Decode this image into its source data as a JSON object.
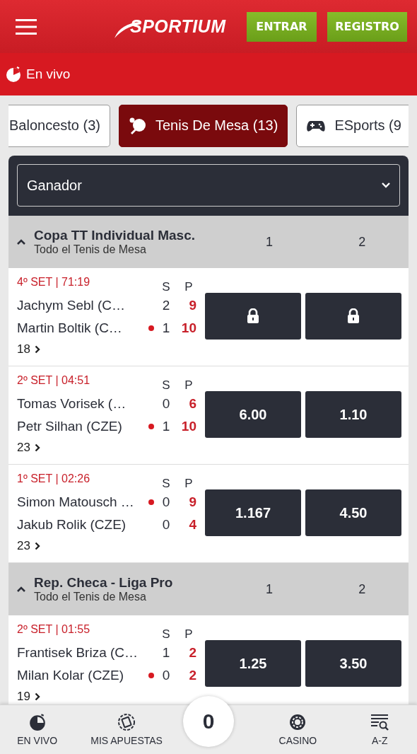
{
  "header": {
    "logo": "SPORTIUM",
    "buttons": [
      {
        "label": "ENTRAR"
      },
      {
        "label": "REGISTRO"
      }
    ]
  },
  "live_bar": {
    "label": "En vivo"
  },
  "sport_tabs": [
    {
      "label": "Baloncesto (3)",
      "selected": false,
      "kind": "plain"
    },
    {
      "label": "Tenis De Mesa (13)",
      "selected": true,
      "kind": "paddle"
    },
    {
      "label": "ESports (9",
      "selected": false,
      "kind": "gamepad"
    }
  ],
  "market_select": {
    "value": "Ganador"
  },
  "groups": [
    {
      "title": "Copa TT Individual Masc.",
      "subtitle": "Todo el Tenis de Mesa",
      "expanded": true,
      "columns": [
        "1",
        "2"
      ],
      "matches": [
        {
          "status": "4º SET | 71:19",
          "score_headers": [
            "S",
            "P"
          ],
          "players": [
            {
              "name": "Jachym Sebl (C…",
              "serving": false,
              "sets": "2",
              "points": "9"
            },
            {
              "name": "Martin Boltik (C…",
              "serving": true,
              "sets": "1",
              "points": "10"
            }
          ],
          "odds": [
            {
              "locked": true
            },
            {
              "locked": true
            }
          ],
          "more": "18"
        },
        {
          "status": "2º SET | 04:51",
          "score_headers": [
            "S",
            "P"
          ],
          "players": [
            {
              "name": "Tomas Vorisek (…",
              "serving": false,
              "sets": "0",
              "points": "6"
            },
            {
              "name": "Petr Silhan (CZE)",
              "serving": true,
              "sets": "1",
              "points": "10"
            }
          ],
          "odds": [
            {
              "locked": false,
              "value": "6.00"
            },
            {
              "locked": false,
              "value": "1.10"
            }
          ],
          "more": "23"
        },
        {
          "status": "1º SET | 02:26",
          "score_headers": [
            "S",
            "P"
          ],
          "players": [
            {
              "name": "Simon Matousch …",
              "serving": true,
              "sets": "0",
              "points": "9"
            },
            {
              "name": "Jakub Rolik (CZE)",
              "serving": false,
              "sets": "0",
              "points": "4"
            }
          ],
          "odds": [
            {
              "locked": false,
              "value": "1.167"
            },
            {
              "locked": false,
              "value": "4.50"
            }
          ],
          "more": "23"
        }
      ]
    },
    {
      "title": "Rep. Checa - Liga Pro",
      "subtitle": "Todo el Tenis de Mesa",
      "expanded": true,
      "columns": [
        "1",
        "2"
      ],
      "matches": [
        {
          "status": "2º SET | 01:55",
          "score_headers": [
            "S",
            "P"
          ],
          "players": [
            {
              "name": "Frantisek Briza (C…",
              "serving": false,
              "sets": "1",
              "points": "2"
            },
            {
              "name": "Milan Kolar (CZE)",
              "serving": true,
              "sets": "0",
              "points": "2"
            }
          ],
          "odds": [
            {
              "locked": false,
              "value": "1.25"
            },
            {
              "locked": false,
              "value": "3.50"
            }
          ],
          "more": "19"
        }
      ]
    }
  ],
  "bottom_nav": {
    "items": [
      {
        "label": "EN VIVO",
        "kind": "live"
      },
      {
        "label": "MIS APUESTAS",
        "kind": "bets"
      },
      {
        "label": "CASINO",
        "kind": "casino"
      },
      {
        "label": "A-Z",
        "kind": "az"
      }
    ],
    "bet_count": "0"
  }
}
